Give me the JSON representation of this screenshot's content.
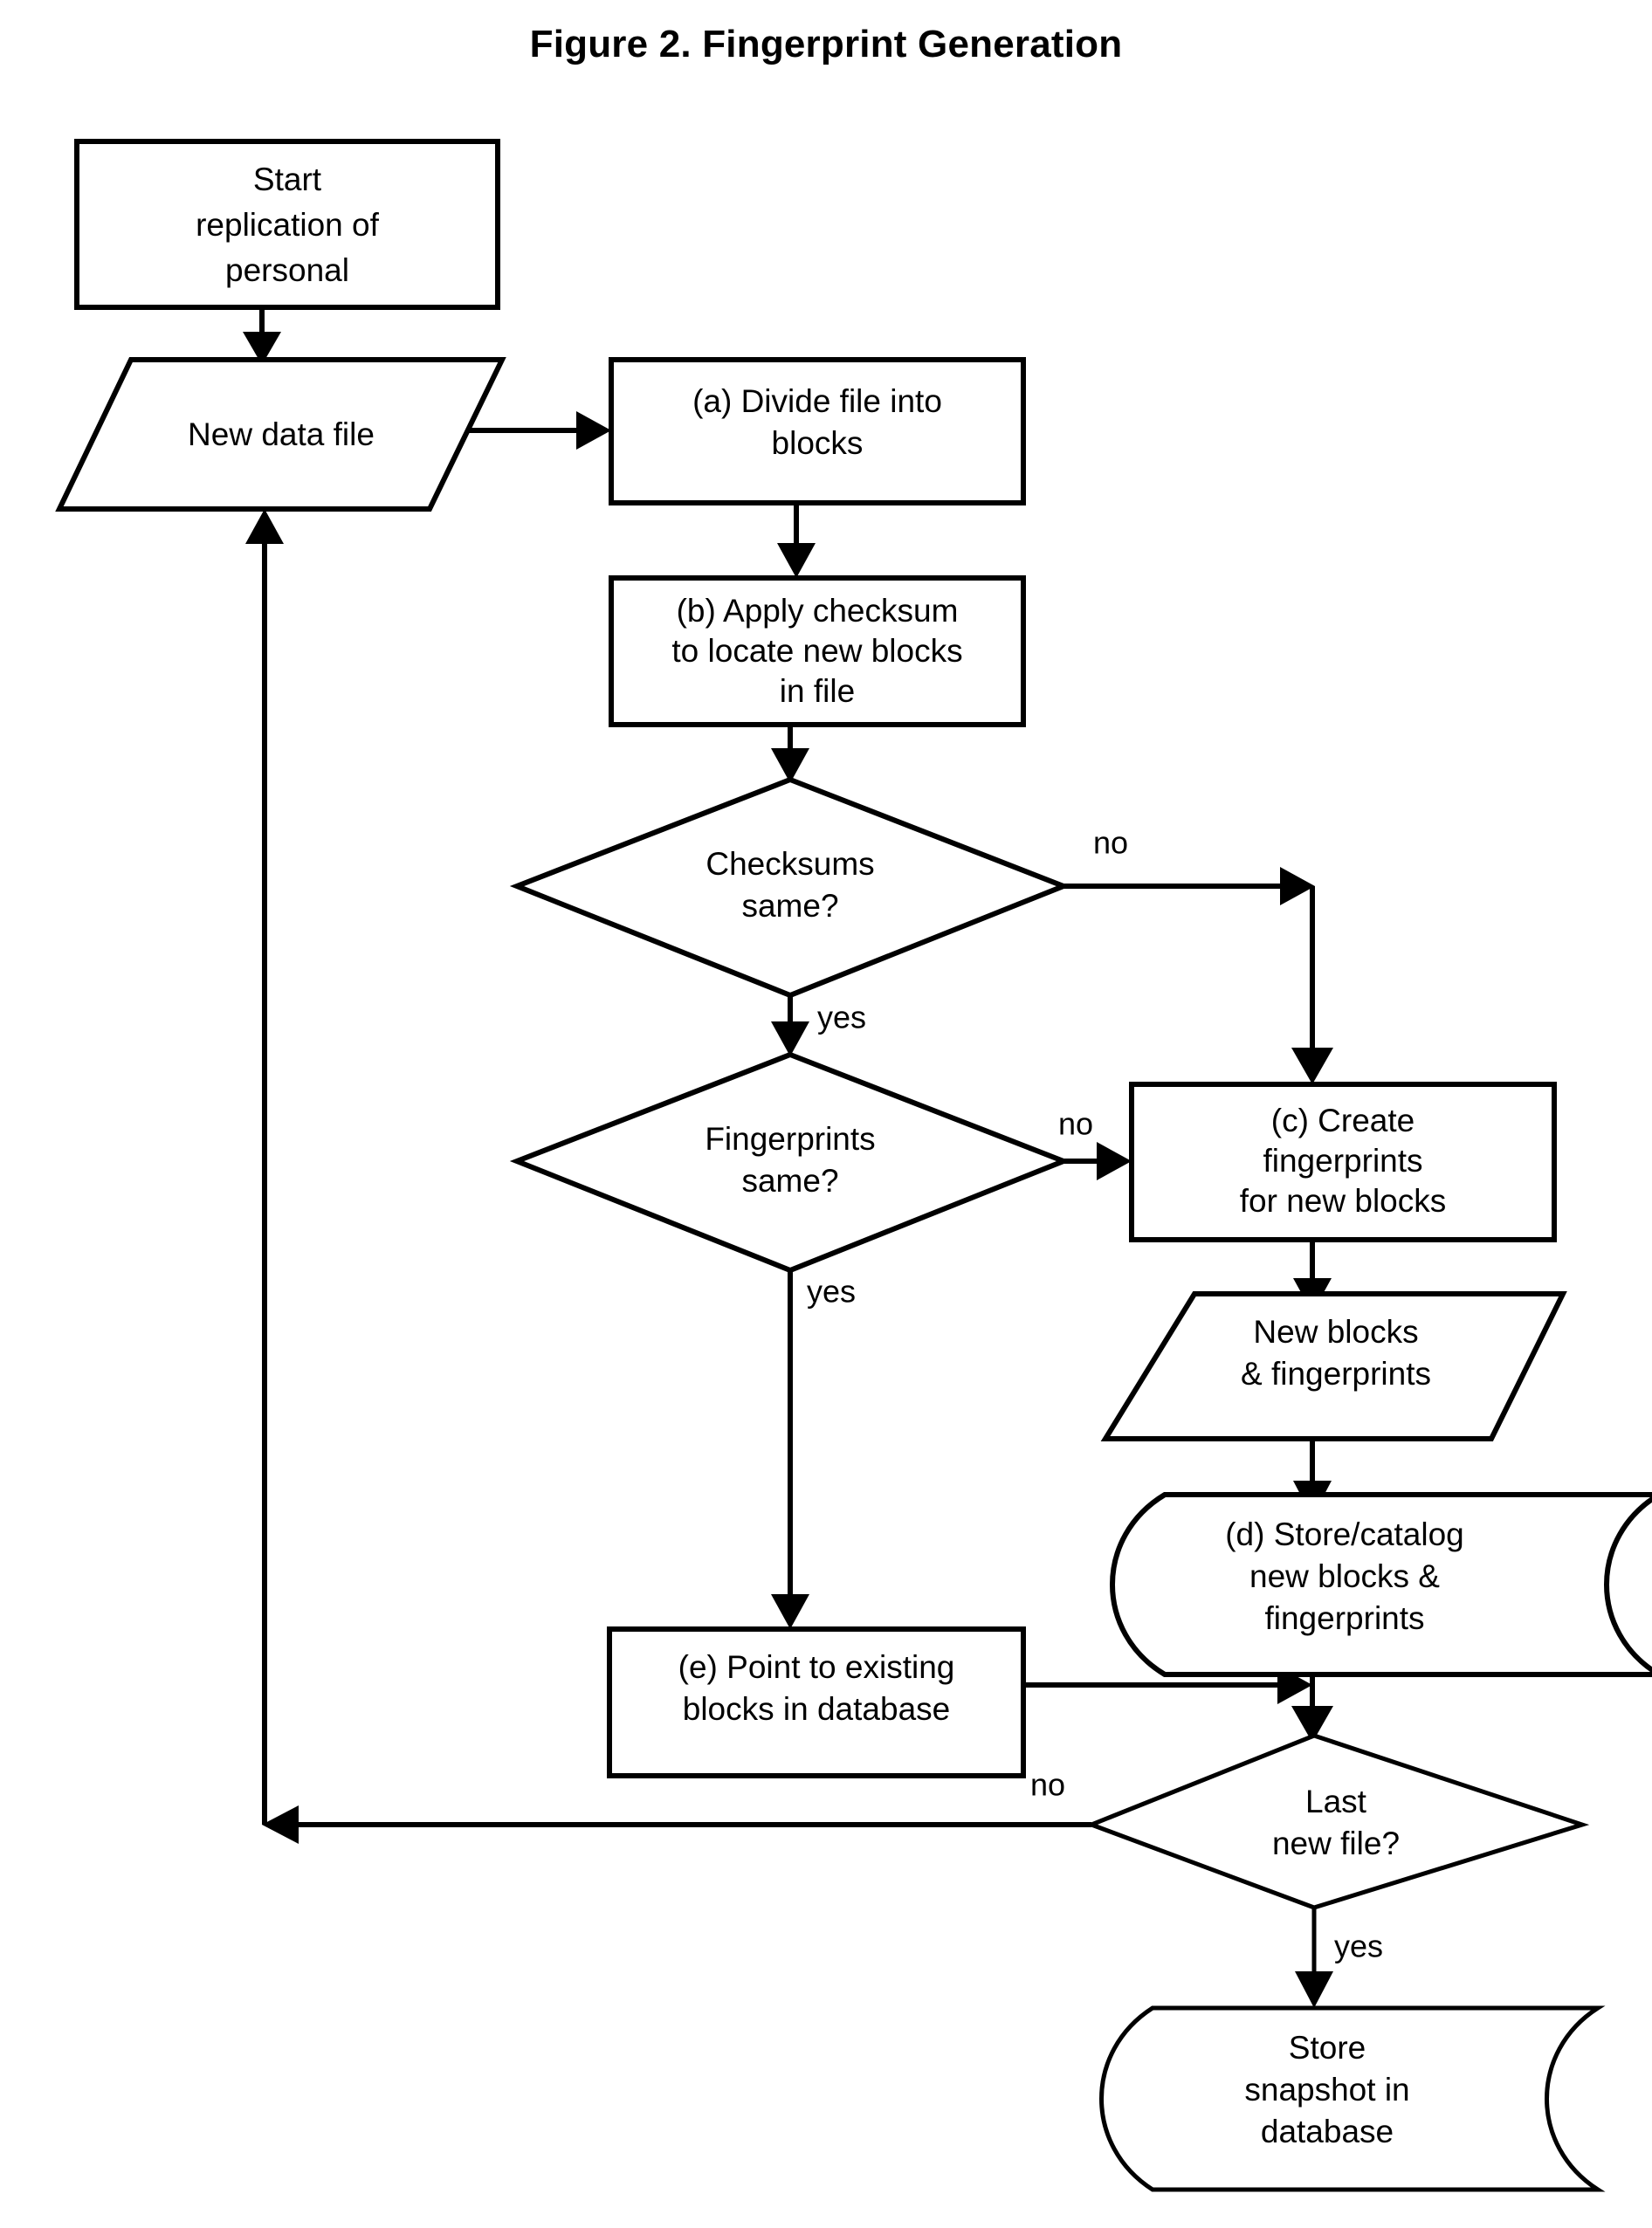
{
  "figure": {
    "title": "Figure 2.  Fingerprint Generation"
  },
  "nodes": {
    "start": {
      "type": "process-terminator",
      "lines": [
        "Start",
        "replication of",
        "personal"
      ]
    },
    "new_data_file": {
      "type": "data-parallelogram",
      "lines": [
        "New data file"
      ]
    },
    "step_a": {
      "type": "process",
      "lines": [
        "(a)  Divide file into",
        "blocks"
      ]
    },
    "step_b": {
      "type": "process",
      "lines": [
        "(b) Apply checksum",
        "to locate new blocks",
        "in file"
      ]
    },
    "checksums_same": {
      "type": "decision",
      "lines": [
        "Checksums",
        "same?"
      ]
    },
    "fingerprints_same": {
      "type": "decision",
      "lines": [
        "Fingerprints",
        "same?"
      ]
    },
    "step_c": {
      "type": "process",
      "lines": [
        "(c) Create",
        "fingerprints",
        "for new blocks"
      ]
    },
    "new_blocks_fingerprints": {
      "type": "data-parallelogram",
      "lines": [
        "New blocks",
        "& fingerprints"
      ]
    },
    "step_d": {
      "type": "stored-data",
      "lines": [
        "(d) Store/catalog",
        "new blocks &",
        "fingerprints"
      ]
    },
    "step_e": {
      "type": "process",
      "lines": [
        "(e) Point to existing",
        "blocks in database"
      ]
    },
    "last_new_file": {
      "type": "decision",
      "lines": [
        "Last",
        "new file?"
      ]
    },
    "store_snapshot": {
      "type": "stored-data",
      "lines": [
        "Store",
        "snapshot in",
        "database"
      ]
    }
  },
  "edge_labels": {
    "checksums_no": "no",
    "checksums_yes": "yes",
    "fingerprints_no": "no",
    "fingerprints_yes": "yes",
    "last_new_file_no": "no",
    "last_new_file_yes": "yes"
  },
  "colors": {
    "stroke": "#000000",
    "fill": "#ffffff",
    "background": "#ffffff"
  }
}
